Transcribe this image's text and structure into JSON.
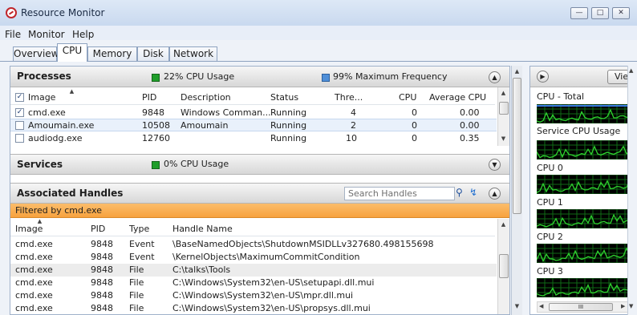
{
  "window": {
    "title": "Resource Monitor",
    "btn_minimize": "—",
    "btn_maximize": "□",
    "btn_close": "✕"
  },
  "menu": [
    "File",
    "Monitor",
    "Help"
  ],
  "tabs": [
    {
      "label": "Overview",
      "active": false
    },
    {
      "label": "CPU",
      "active": true
    },
    {
      "label": "Memory",
      "active": false
    },
    {
      "label": "Disk",
      "active": false
    },
    {
      "label": "Network",
      "active": false
    }
  ],
  "processes": {
    "title": "Processes",
    "cpu_usage": "22% CPU Usage",
    "max_frequency": "99% Maximum Frequency",
    "columns": [
      "Image",
      "PID",
      "Description",
      "Status",
      "Thre...",
      "CPU",
      "Average CPU"
    ],
    "rows": [
      {
        "checked": true,
        "image": "cmd.exe",
        "pid": "9848",
        "description": "Windows Comman...",
        "status": "Running",
        "threads": "4",
        "cpu": "0",
        "avg_cpu": "0.00"
      },
      {
        "checked": false,
        "image": "Amoumain.exe",
        "pid": "10508",
        "description": "Amoumain",
        "status": "Running",
        "threads": "2",
        "cpu": "0",
        "avg_cpu": "0.00"
      },
      {
        "checked": false,
        "image": "audiodg.exe",
        "pid": "12760",
        "description": "",
        "status": "Running",
        "threads": "10",
        "cpu": "0",
        "avg_cpu": "0.35"
      }
    ]
  },
  "services": {
    "title": "Services",
    "cpu_usage": "0% CPU Usage"
  },
  "handles": {
    "title": "Associated Handles",
    "search_placeholder": "Search Handles",
    "filter": "Filtered by cmd.exe",
    "columns": [
      "Image",
      "PID",
      "Type",
      "Handle Name"
    ],
    "rows": [
      {
        "image": "cmd.exe",
        "pid": "9848",
        "type": "Event",
        "name": "\\BaseNamedObjects\\ShutdownMSIDLLv327680.498155698"
      },
      {
        "image": "cmd.exe",
        "pid": "9848",
        "type": "Event",
        "name": "\\KernelObjects\\MaximumCommitCondition"
      },
      {
        "image": "cmd.exe",
        "pid": "9848",
        "type": "File",
        "name": "C:\\talks\\Tools"
      },
      {
        "image": "cmd.exe",
        "pid": "9848",
        "type": "File",
        "name": "C:\\Windows\\System32\\en-US\\setupapi.dll.mui"
      },
      {
        "image": "cmd.exe",
        "pid": "9848",
        "type": "File",
        "name": "C:\\Windows\\System32\\en-US\\mpr.dll.mui"
      },
      {
        "image": "cmd.exe",
        "pid": "9848",
        "type": "File",
        "name": "C:\\Windows\\System32\\en-US\\propsys.dll.mui"
      }
    ]
  },
  "right": {
    "views_label": "Vie",
    "graphs": [
      "CPU - Total",
      "Service CPU Usage",
      "CPU 0",
      "CPU 1",
      "CPU 2",
      "CPU 3"
    ],
    "hscroll_thumb": "III"
  },
  "colors": {
    "cpu_green": "#1f9e2a",
    "freq_blue": "#4f8fd8",
    "filter_orange": "#f7a23e",
    "graph_green": "#2fd32f",
    "graph_blue": "#3a7ce0"
  }
}
